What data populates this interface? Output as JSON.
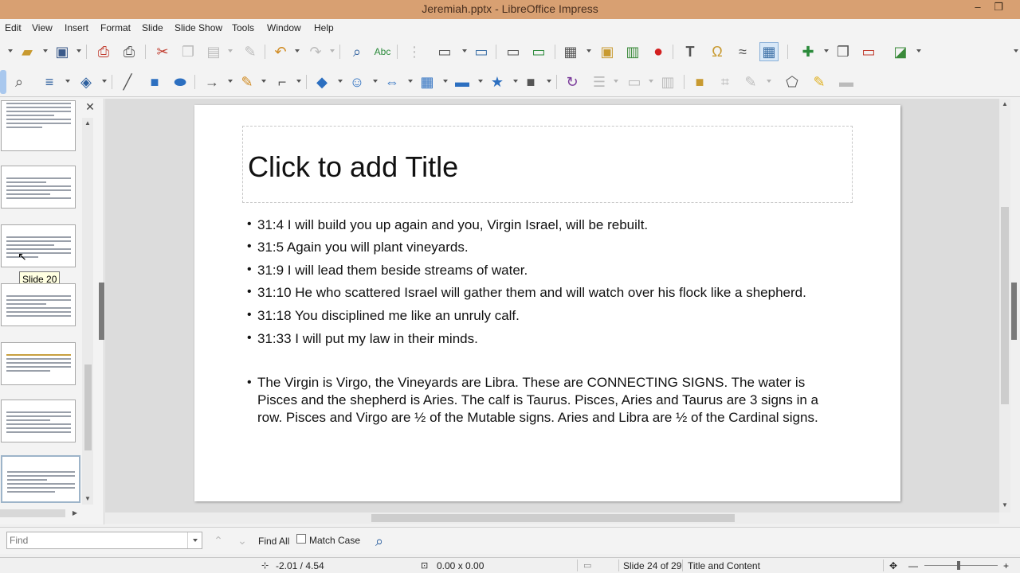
{
  "window": {
    "title": "Jeremiah.pptx - LibreOffice Impress",
    "minimize_glyph": "–",
    "restore_glyph": "❐"
  },
  "menu": [
    "Edit",
    "View",
    "Insert",
    "Format",
    "Slide",
    "Slide Show",
    "Tools",
    "Window",
    "Help"
  ],
  "slide_pane": {
    "close_glyph": "✕",
    "tooltip": "Slide 20",
    "scroll_up": "▲",
    "scroll_down": "▼",
    "scroll_right": "▶"
  },
  "slide": {
    "title_placeholder": "Click to add Title",
    "bullets": [
      "31:4 I will build you up again and you, Virgin Israel, will be rebuilt.",
      "31:5 Again you will plant vineyards.",
      "31:9 I will lead them beside streams of water.",
      "31:10 He who scattered Israel will gather them and will watch over his flock like a shepherd.",
      "31:18 You disciplined me like an unruly calf.",
      "31:33 I will put my law in their minds."
    ],
    "paragraph_lines": [
      "The Virgin is Virgo, the Vineyards are Libra. These are CONNECTING SIGNS. The water is",
      "Pisces and the shepherd is Aries. The calf is Taurus. Pisces, Aries and Taurus are 3 signs in a",
      "row. Pisces and Virgo are ½ of the Mutable signs. Aries and Libra are ½ of the Cardinal signs."
    ]
  },
  "findbar": {
    "placeholder": "Find",
    "find_all": "Find All",
    "match_case": "Match Case"
  },
  "statusbar": {
    "position": "-2.01 / 4.54",
    "size": "0.00 x 0.00",
    "slide": "Slide 24 of 29",
    "layout": "Title and Content",
    "zoom_minus": "—",
    "zoom_plus": "+"
  }
}
